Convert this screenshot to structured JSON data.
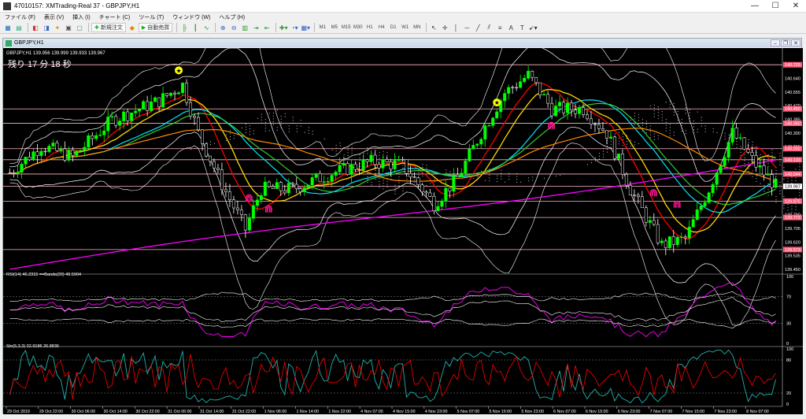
{
  "window": {
    "title": "47010157: XMTrading-Real 37 - GBPJPY,H1",
    "minimize": "—",
    "maximize": "☐",
    "close": "✕"
  },
  "menu": [
    "ファイル (F)",
    "表示 (V)",
    "挿入 (I)",
    "チャート (C)",
    "ツール (T)",
    "ウィンドウ (W)",
    "ヘルプ (H)"
  ],
  "toolbar": {
    "new_order": "新規注文",
    "auto_trade": "自動売買",
    "timeframes": [
      "M1",
      "M5",
      "M15",
      "M30",
      "H1",
      "H4",
      "D1",
      "W1",
      "MN"
    ]
  },
  "chart_window": {
    "title": "GBPJPY,H1",
    "header": "GBPJPY,H1  139.956 139.999 139.933 139.967",
    "countdown": "残り 17 分 18 秒"
  },
  "price_axis": {
    "labels": [
      "140.725",
      "140.640",
      "140.555",
      "140.470",
      "140.385",
      "140.300",
      "140.215",
      "140.130",
      "140.045",
      "139.960",
      "139.875",
      "139.790",
      "139.705",
      "139.620",
      "139.535",
      "139.450"
    ],
    "highlighted": [
      {
        "label": "140.725",
        "price": 140.725
      },
      {
        "label": "140.450",
        "price": 140.45
      },
      {
        "label": "140.360",
        "price": 140.36
      },
      {
        "label": "140.202",
        "price": 140.202
      },
      {
        "label": "140.133",
        "price": 140.133
      },
      {
        "label": "140.044",
        "price": 140.044
      },
      {
        "label": "139.967",
        "price": 139.967
      },
      {
        "label": "139.875",
        "price": 139.875
      },
      {
        "label": "139.773",
        "price": 139.773
      },
      {
        "label": "139.573",
        "price": 139.573
      }
    ]
  },
  "rsi_panel": {
    "header": "RSI(14) 46.2315  ==Bands(20) 49.5904",
    "levels": [
      "100",
      "70",
      "30",
      "0"
    ]
  },
  "stoch_panel": {
    "header": "Sto(5,3,3) 32.9186 26.8836",
    "levels": [
      "100",
      "80",
      "20",
      "0"
    ]
  },
  "time_axis": [
    "29 Oct 2019",
    "29 Oct 22:00",
    "30 Oct 06:00",
    "30 Oct 14:00",
    "30 Oct 22:00",
    "31 Oct 06:00",
    "31 Oct 14:00",
    "31 Oct 22:00",
    "1 Nov 06:00",
    "1 Nov 14:00",
    "1 Nov 22:00",
    "4 Nov 07:00",
    "4 Nov 15:00",
    "4 Nov 23:00",
    "5 Nov 07:00",
    "5 Nov 15:00",
    "5 Nov 23:00",
    "6 Nov 07:00",
    "6 Nov 15:00",
    "6 Nov 23:00",
    "7 Nov 07:00",
    "7 Nov 15:00",
    "7 Nov 23:00",
    "8 Nov 07:00"
  ],
  "colors": {
    "background": "#000000",
    "bull": "#00ff00",
    "bear": "#ffffff",
    "tenkan": "#ff0000",
    "kijun": "#00e5ff",
    "ma_fast": "#ffd700",
    "ma_mid": "#32cd32",
    "ma_slow": "#ff8c00",
    "ma_long": "#ff00ff",
    "bands": "#ffffff",
    "level_line": "#ffb6c1",
    "arrow_marker": "#ff1493",
    "star_marker": "#ffff00"
  },
  "markers": [
    {
      "type": "star",
      "bar": 43,
      "price": 140.69
    },
    {
      "type": "star",
      "bar": 124,
      "price": 140.49
    },
    {
      "type": "arrow-up",
      "bar": 61,
      "price": 139.9
    },
    {
      "type": "arrow-up",
      "bar": 66,
      "price": 139.83
    },
    {
      "type": "arrow-up",
      "bar": 138,
      "price": 140.35
    },
    {
      "type": "arrow-up",
      "bar": 164,
      "price": 139.93
    },
    {
      "type": "arrow-up",
      "bar": 170,
      "price": 139.86
    }
  ]
}
